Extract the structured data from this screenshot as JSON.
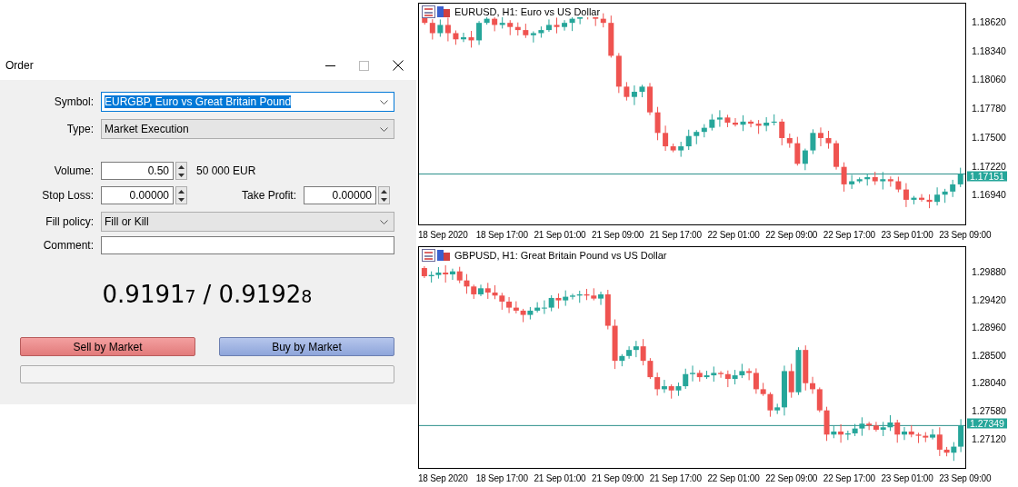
{
  "order_dialog": {
    "title": "Order",
    "symbol": {
      "label": "Symbol:",
      "value": "EURGBP, Euro vs Great Britain Pound",
      "text_selected": true
    },
    "type": {
      "label": "Type:",
      "value": "Market Execution"
    },
    "volume": {
      "label": "Volume:",
      "value": "0.50",
      "note": "50 000 EUR"
    },
    "stop_loss": {
      "label": "Stop Loss:",
      "value": "0.00000"
    },
    "take_profit": {
      "label": "Take Profit:",
      "value": "0.00000"
    },
    "fill_policy": {
      "label": "Fill policy:",
      "value": "Fill or Kill"
    },
    "comment": {
      "label": "Comment:"
    },
    "quote": {
      "bid": "0.9191",
      "bid_last": "7",
      "separator": "/",
      "ask": "0.9192",
      "ask_last": "8"
    },
    "sell_button": "Sell by Market",
    "buy_button": "Buy by Market"
  },
  "charts": [
    {
      "title": "EURUSD, H1:  Euro vs US Dollar",
      "current_price": "1.17151",
      "price_labels": [
        "1.18620",
        "1.18340",
        "1.18060",
        "1.17780",
        "1.17500",
        "1.17220",
        "1.16940"
      ],
      "time_labels": [
        "18 Sep 2020",
        "18 Sep 17:00",
        "21 Sep 01:00",
        "21 Sep 09:00",
        "21 Sep 17:00",
        "22 Sep 01:00",
        "22 Sep 09:00",
        "22 Sep 17:00",
        "23 Sep 01:00",
        "23 Sep 09:00"
      ]
    },
    {
      "title": "GBPUSD, H1:  Great Britain Pound vs US Dollar",
      "current_price": "1.27349",
      "price_labels": [
        "1.29880",
        "1.29420",
        "1.28960",
        "1.28500",
        "1.28040",
        "1.27580",
        "1.27120"
      ],
      "time_labels": [
        "18 Sep 2020",
        "18 Sep 17:00",
        "21 Sep 01:00",
        "21 Sep 09:00",
        "21 Sep 17:00",
        "22 Sep 01:00",
        "22 Sep 09:00",
        "22 Sep 17:00",
        "23 Sep 01:00",
        "23 Sep 09:00"
      ]
    }
  ]
}
